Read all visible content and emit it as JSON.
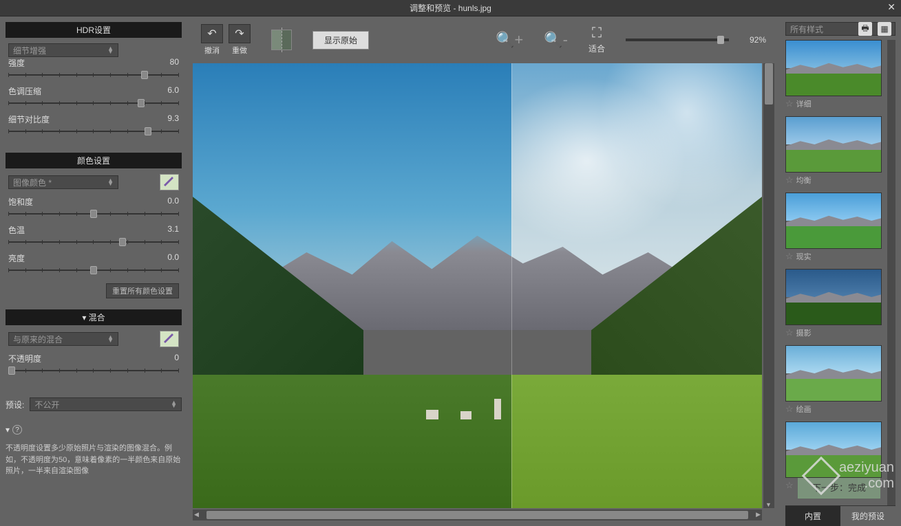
{
  "title": "调整和预览 - hunls.jpg",
  "left": {
    "hdr": {
      "title": "HDR设置",
      "mode": "细节增强",
      "sliders": [
        {
          "label": "强度",
          "value": "80",
          "pos": 80
        },
        {
          "label": "色调压缩",
          "value": "6.0",
          "pos": 78
        },
        {
          "label": "细节对比度",
          "value": "9.3",
          "pos": 82
        }
      ]
    },
    "color": {
      "title": "颜色设置",
      "mode": "图像颜色 *",
      "sliders": [
        {
          "label": "饱和度",
          "value": "0.0",
          "pos": 50
        },
        {
          "label": "色温",
          "value": "3.1",
          "pos": 67
        },
        {
          "label": "亮度",
          "value": "0.0",
          "pos": 50
        }
      ],
      "reset": "重置所有颜色设置"
    },
    "blend": {
      "title": "混合",
      "mode": "与原来的混合",
      "slider": {
        "label": "不透明度",
        "value": "0",
        "pos": 2
      }
    },
    "preset_label": "预设:",
    "preset_value": "不公开",
    "help": "不透明度设置多少原始照片与渲染的图像混合。例如，不透明度为50，意味着像素的一半颜色来自原始照片，一半来自渲染图像"
  },
  "toolbar": {
    "undo": "撤消",
    "redo": "重做",
    "show_original": "显示原始",
    "fit": "适合",
    "zoom": "92%"
  },
  "next_button": "下一步：完成",
  "right": {
    "filter": "所有样式",
    "presets": [
      {
        "name": "详细",
        "sky": "linear-gradient(#3a8ed0,#7ab8e0)",
        "grass": "#4a8a2a"
      },
      {
        "name": "均衡",
        "sky": "linear-gradient(#5a9ed0,#9ac8e8)",
        "grass": "#5a9a3a"
      },
      {
        "name": "现实",
        "sky": "linear-gradient(#4a9ed8,#8ac8f0)",
        "grass": "#4a9a3a"
      },
      {
        "name": "摄影",
        "sky": "linear-gradient(#2a5a8a,#4a7aa8)",
        "grass": "#2a5a1a"
      },
      {
        "name": "绘画",
        "sky": "linear-gradient(#6aaed8,#aad8f0)",
        "grass": "#6aaa4a"
      },
      {
        "name": "",
        "sky": "linear-gradient(#5aa8d8,#9ad0f0)",
        "grass": "#5a9a3a"
      }
    ],
    "tabs": {
      "builtin": "内置",
      "mine": "我的预设"
    }
  },
  "watermark": {
    "line1": "aeziyuan",
    "line2": ".com"
  }
}
